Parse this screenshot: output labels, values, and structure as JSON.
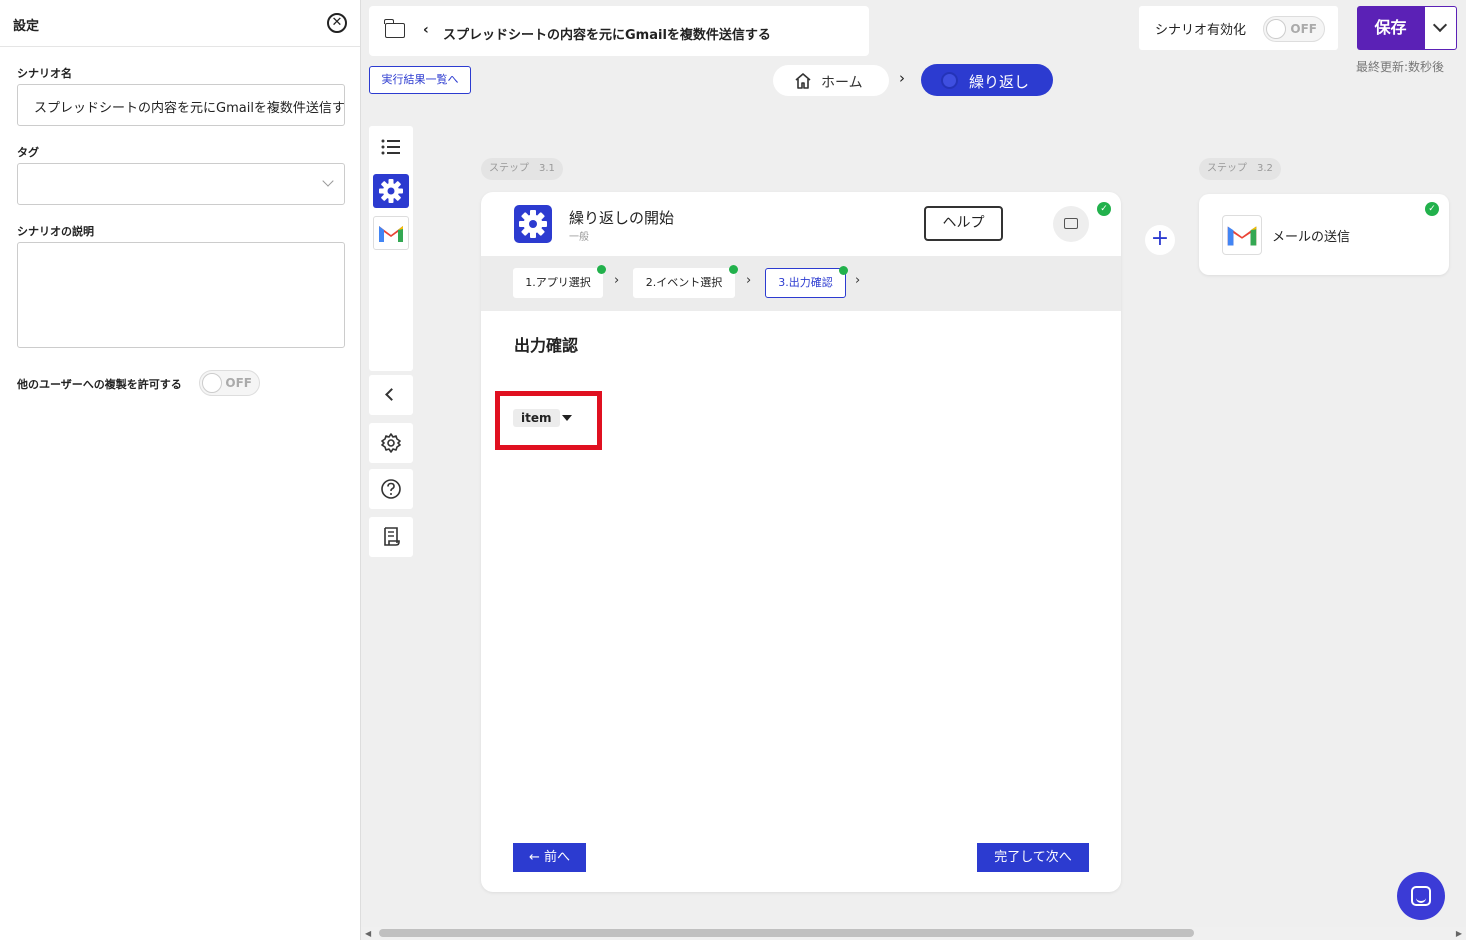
{
  "settings": {
    "title": "設定",
    "scenario_name_label": "シナリオ名",
    "scenario_name_value": "スプレッドシートの内容を元にGmailを複数件送信する",
    "tag_label": "タグ",
    "description_label": "シナリオの説明",
    "allow_copy_label": "他のユーザーへの複製を許可する",
    "allow_copy_state": "OFF"
  },
  "header": {
    "back": "‹",
    "scenario_title": "スプレッドシートの内容を元にGmailを複数件送信する",
    "results_link": "実行結果一覧へ",
    "breadcrumb_home": "ホーム",
    "breadcrumb_sep": "›",
    "breadcrumb_current": "繰り返し",
    "activate_label": "シナリオ有効化",
    "activate_state": "OFF",
    "save_label": "保存",
    "last_updated": "最終更新:数秒後"
  },
  "steps": {
    "step_31_tag": "ステップ　3.1",
    "step_32_tag": "ステップ　3.2",
    "card_title": "繰り返しの開始",
    "card_subtitle": "一般",
    "help_label": "ヘルプ",
    "tabs": [
      {
        "label": "1.アプリ選択",
        "done": true
      },
      {
        "label": "2.イベント選択",
        "done": true
      },
      {
        "label": "3.出力確認",
        "done": true,
        "active": true
      }
    ],
    "tab_sep": "›",
    "output_title": "出力確認",
    "item_label": "item",
    "prev_label": "← 前へ",
    "next_label": "完了して次へ",
    "add_step": "+",
    "mail_card_label": "メールの送信"
  },
  "check_mark": "✓",
  "close_mark": "✕",
  "scroll": {
    "left": "◀",
    "right": "▶"
  },
  "colors": {
    "accent": "#2c3bd0",
    "save": "#5b21b6",
    "check": "#22b14c",
    "highlight": "#e01020"
  },
  "icons": [
    "folder-icon",
    "home-icon",
    "list-icon",
    "gear-icon",
    "gmail-icon",
    "chevron-left-icon",
    "settings-icon",
    "help-icon",
    "log-icon",
    "comment-icon",
    "chat-icon"
  ]
}
